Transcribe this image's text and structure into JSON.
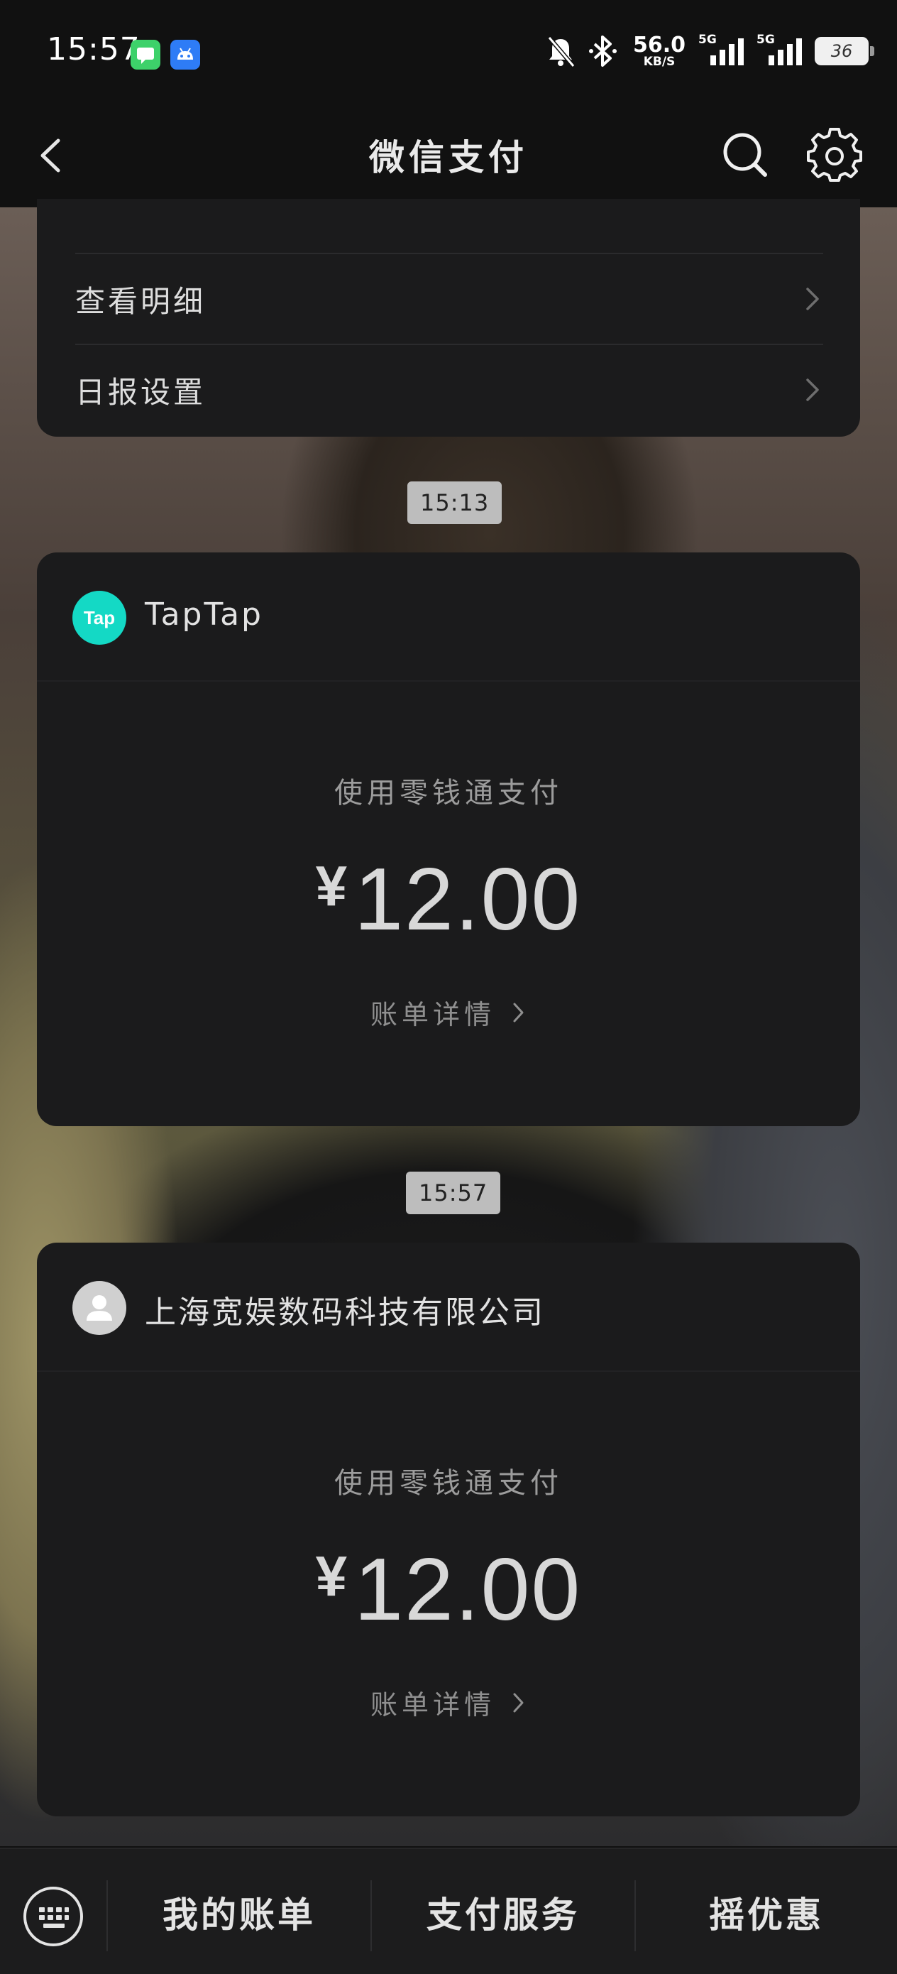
{
  "status_bar": {
    "time": "15:57",
    "net_speed_value": "56.0",
    "net_speed_unit": "KB/S",
    "sim1_tag": "5G",
    "sim2_tag": "5G",
    "battery_level": "36"
  },
  "nav": {
    "title": "微信支付"
  },
  "menu": {
    "items": [
      {
        "label": "查看明细"
      },
      {
        "label": "日报设置"
      }
    ]
  },
  "messages": [
    {
      "time": "15:13",
      "merchant": "TapTap",
      "avatar_text": "Tap",
      "method": "使用零钱通支付",
      "currency": "¥",
      "amount": "12.00",
      "detail_label": "账单详情"
    },
    {
      "time": "15:57",
      "merchant": "上海宽娱数码科技有限公司",
      "method": "使用零钱通支付",
      "currency": "¥",
      "amount": "12.00",
      "detail_label": "账单详情"
    }
  ],
  "bottom_bar": {
    "tabs": [
      {
        "label": "我的账单"
      },
      {
        "label": "支付服务"
      },
      {
        "label": "摇优惠"
      }
    ]
  },
  "colors": {
    "taptap_brand": "#14d9c5",
    "card_bg": "#1b1b1c",
    "app_bar_bg": "#111111"
  }
}
